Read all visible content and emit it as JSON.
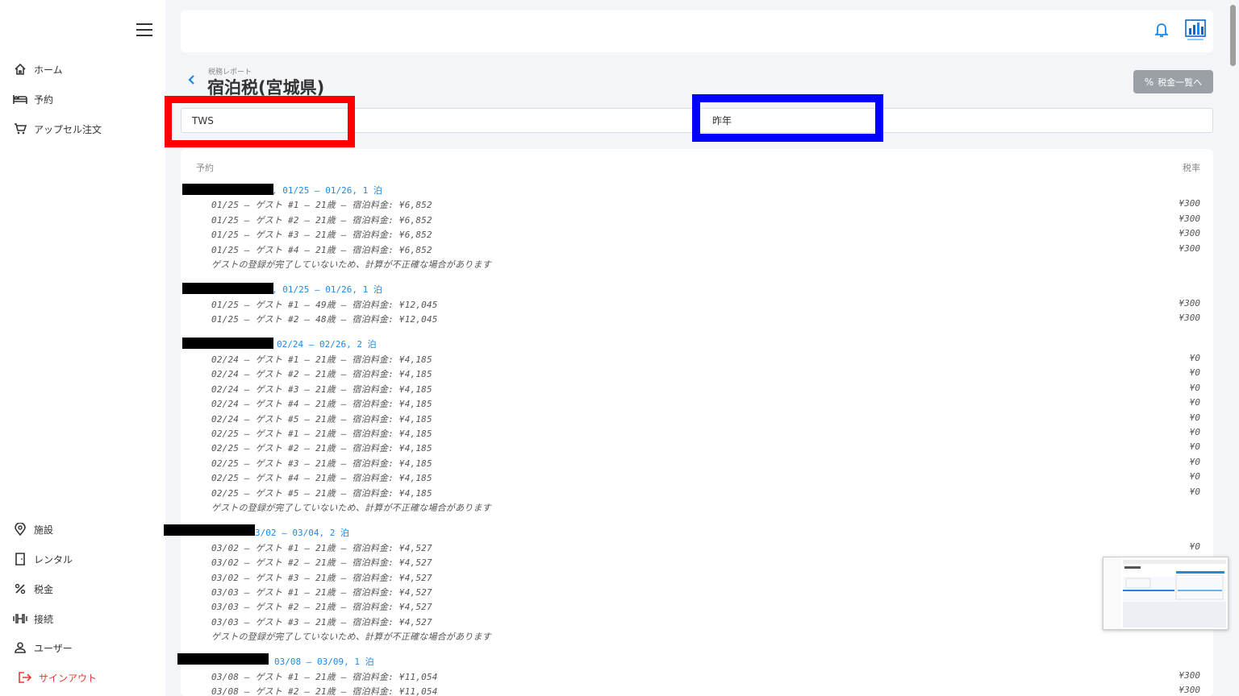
{
  "sidebar": {
    "items": [
      {
        "label": "ホーム"
      },
      {
        "label": "予約"
      },
      {
        "label": "アップセル注文"
      },
      {
        "label": "施設"
      },
      {
        "label": "レンタル"
      },
      {
        "label": "税金"
      },
      {
        "label": "接続"
      },
      {
        "label": "ユーザー"
      },
      {
        "label": "サインアウト"
      }
    ]
  },
  "page": {
    "breadcrumb": "税務レポート",
    "title": "宿泊税(宮城県)",
    "tax_list_button": "税金一覧へ"
  },
  "filters": {
    "property": "TWS",
    "period": "昨年"
  },
  "table": {
    "col_reservation": "予約",
    "col_rate": "税率",
    "reservations": [
      {
        "header": ", 01/25 – 01/26, 1 泊",
        "lines": [
          {
            "text": "01/25 – ゲスト #1 – 21歳 – 宿泊料金: ¥6,852",
            "rate": "¥300"
          },
          {
            "text": "01/25 – ゲスト #2 – 21歳 – 宿泊料金: ¥6,852",
            "rate": "¥300"
          },
          {
            "text": "01/25 – ゲスト #3 – 21歳 – 宿泊料金: ¥6,852",
            "rate": "¥300"
          },
          {
            "text": "01/25 – ゲスト #4 – 21歳 – 宿泊料金: ¥6,852",
            "rate": "¥300"
          }
        ],
        "note": "ゲストの登録が完了していないため、計算が不正確な場合があります"
      },
      {
        "header": ", 01/25 – 01/26, 1 泊",
        "lines": [
          {
            "text": "01/25 – ゲスト #1 – 49歳 – 宿泊料金: ¥12,045",
            "rate": "¥300"
          },
          {
            "text": "01/25 – ゲスト #2 – 48歳 – 宿泊料金: ¥12,045",
            "rate": "¥300"
          }
        ],
        "note": ""
      },
      {
        "header": "02/24 – 02/26, 2 泊",
        "lines": [
          {
            "text": "02/24 – ゲスト #1 – 21歳 – 宿泊料金: ¥4,185",
            "rate": "¥0"
          },
          {
            "text": "02/24 – ゲスト #2 – 21歳 – 宿泊料金: ¥4,185",
            "rate": "¥0"
          },
          {
            "text": "02/24 – ゲスト #3 – 21歳 – 宿泊料金: ¥4,185",
            "rate": "¥0"
          },
          {
            "text": "02/24 – ゲスト #4 – 21歳 – 宿泊料金: ¥4,185",
            "rate": "¥0"
          },
          {
            "text": "02/24 – ゲスト #5 – 21歳 – 宿泊料金: ¥4,185",
            "rate": "¥0"
          },
          {
            "text": "02/25 – ゲスト #1 – 21歳 – 宿泊料金: ¥4,185",
            "rate": "¥0"
          },
          {
            "text": "02/25 – ゲスト #2 – 21歳 – 宿泊料金: ¥4,185",
            "rate": "¥0"
          },
          {
            "text": "02/25 – ゲスト #3 – 21歳 – 宿泊料金: ¥4,185",
            "rate": "¥0"
          },
          {
            "text": "02/25 – ゲスト #4 – 21歳 – 宿泊料金: ¥4,185",
            "rate": "¥0"
          },
          {
            "text": "02/25 – ゲスト #5 – 21歳 – 宿泊料金: ¥4,185",
            "rate": "¥0"
          }
        ],
        "note": "ゲストの登録が完了していないため、計算が不正確な場合があります"
      },
      {
        "header": "3/02 – 03/04, 2 泊",
        "lines": [
          {
            "text": "03/02 – ゲスト #1 – 21歳 – 宿泊料金: ¥4,527",
            "rate": "¥0"
          },
          {
            "text": "03/02 – ゲスト #2 – 21歳 – 宿泊料金: ¥4,527",
            "rate": ""
          },
          {
            "text": "03/02 – ゲスト #3 – 21歳 – 宿泊料金: ¥4,527",
            "rate": ""
          },
          {
            "text": "03/03 – ゲスト #1 – 21歳 – 宿泊料金: ¥4,527",
            "rate": ""
          },
          {
            "text": "03/03 – ゲスト #2 – 21歳 – 宿泊料金: ¥4,527",
            "rate": ""
          },
          {
            "text": "03/03 – ゲスト #3 – 21歳 – 宿泊料金: ¥4,527",
            "rate": ""
          }
        ],
        "note": "ゲストの登録が完了していないため、計算が不正確な場合があります"
      },
      {
        "header": "03/08 – 03/09, 1 泊",
        "lines": [
          {
            "text": "03/08 – ゲスト #1 – 21歳 – 宿泊料金: ¥11,054",
            "rate": "¥300"
          },
          {
            "text": "03/08 – ゲスト #2 – 21歳 – 宿泊料金: ¥11,054",
            "rate": "¥300"
          }
        ],
        "note": ""
      }
    ]
  },
  "colors": {
    "link_blue": "#1e88e5",
    "signout_red": "#e53935",
    "annotation_red": "#ff0000",
    "annotation_blue": "#0000ff"
  }
}
